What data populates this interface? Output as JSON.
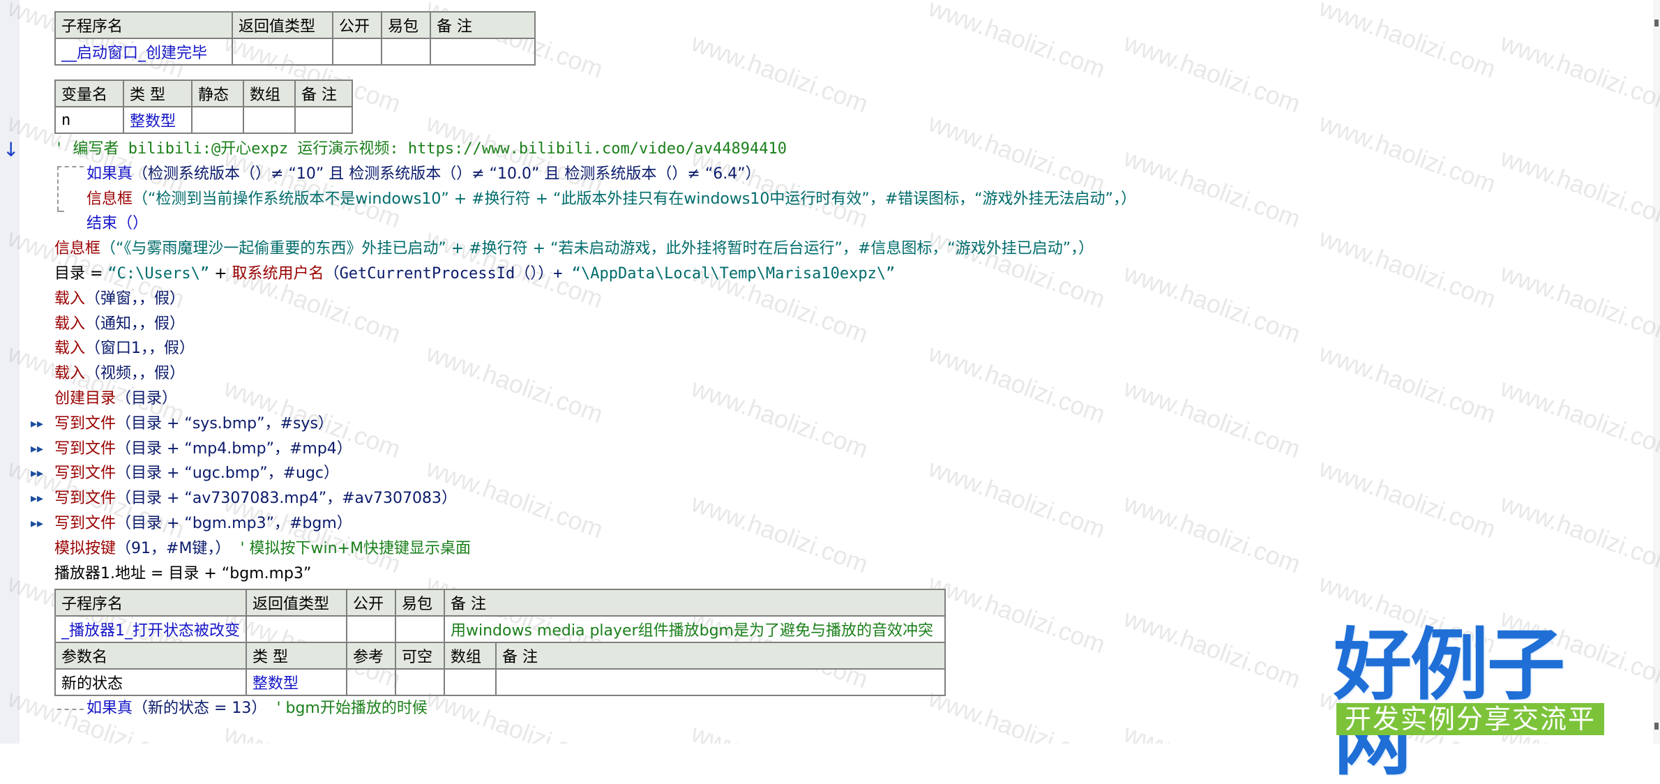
{
  "watermark_text": "www.haolizi.com",
  "sub1": {
    "headers": [
      "子程序名",
      "返回值类型",
      "公开",
      "易包",
      "备 注"
    ],
    "name": "__启动窗口_创建完毕"
  },
  "vars": {
    "headers": [
      "变量名",
      "类 型",
      "静态",
      "数组",
      "备 注"
    ],
    "name": "n",
    "type": "整数型"
  },
  "lines": {
    "l1": "' 编写者 bilibili:@开心expz  运行演示视频: https://www.bilibili.com/video/av44894410",
    "l2_kw": "如果真",
    "l2_rest": "（检测系统版本（）≠ “10” 且 检测系统版本（）≠ “10.0” 且 检测系统版本（）≠ “6.4”）",
    "l3_kw": "信息框",
    "l3_rest": "（“检测到当前操作系统版本不是windows10” + #换行符 + “此版本外挂只有在windows10中运行时有效”，#错误图标，“游戏外挂无法启动”，）",
    "l4": "结束（）",
    "l5_kw": "信息框",
    "l5_rest": "（“《与雾雨魔理沙一起偷重要的东西》外挂已启动” + #换行符 + “若未启动游戏，此外挂将暂时在后台运行”，#信息图标，“游戏外挂已启动”，）",
    "l6_a": "目录 = ",
    "l6_b": "“C:\\Users\\”",
    "l6_c": " + ",
    "l6_kw": "取系统用户名",
    "l6_d": "（GetCurrentProcessId（））+ ",
    "l6_e": "“\\AppData\\Local\\Temp\\Marisa10expz\\”",
    "load_kw": "载入",
    "load1": "（弹窗，，假）",
    "load2": "（通知，，假）",
    "load3": "（窗口1，，假）",
    "load4": "（视频，，假）",
    "mkdir_kw": "创建目录",
    "mkdir_rest": "（目录）",
    "write_kw": "写到文件",
    "write1": "（目录 + “sys.bmp”，#sys）",
    "write2": "（目录 + “mp4.bmp”，#mp4）",
    "write3": "（目录 + “ugc.bmp”，#ugc）",
    "write4": "（目录 + “av7307083.mp4”，#av7307083）",
    "write5": "（目录 + “bgm.mp3”，#bgm）",
    "key_kw": "模拟按键",
    "key_rest": "（91，#M键，）",
    "key_comment": "' 模拟按下win+M快捷键显示桌面",
    "player": "播放器1.地址 = 目录 + “bgm.mp3”"
  },
  "sub2": {
    "headers": [
      "子程序名",
      "返回值类型",
      "公开",
      "易包",
      "备 注"
    ],
    "name": "_播放器1_打开状态被改变",
    "note": "用windows media player组件播放bgm是为了避免与播放的音效冲突",
    "param_headers": [
      "参数名",
      "类 型",
      "参考",
      "可空",
      "数组",
      "备 注"
    ],
    "param_name": "新的状态",
    "param_type": "整数型"
  },
  "last_line": {
    "kw": "如果真",
    "rest": "（新的状态 = 13）",
    "comment": "' bgm开始播放的时候"
  },
  "logo": {
    "title": "好例子网",
    "subtitle": "开发实例分享交流平台"
  },
  "colors": {
    "keyword_blue": "#1515c8",
    "command_red": "#990000",
    "comment_green": "#1a7f1a",
    "header_bg": "#e2e8df",
    "logo_blue": "#1f6fd6",
    "logo_green": "#7cc33a"
  }
}
